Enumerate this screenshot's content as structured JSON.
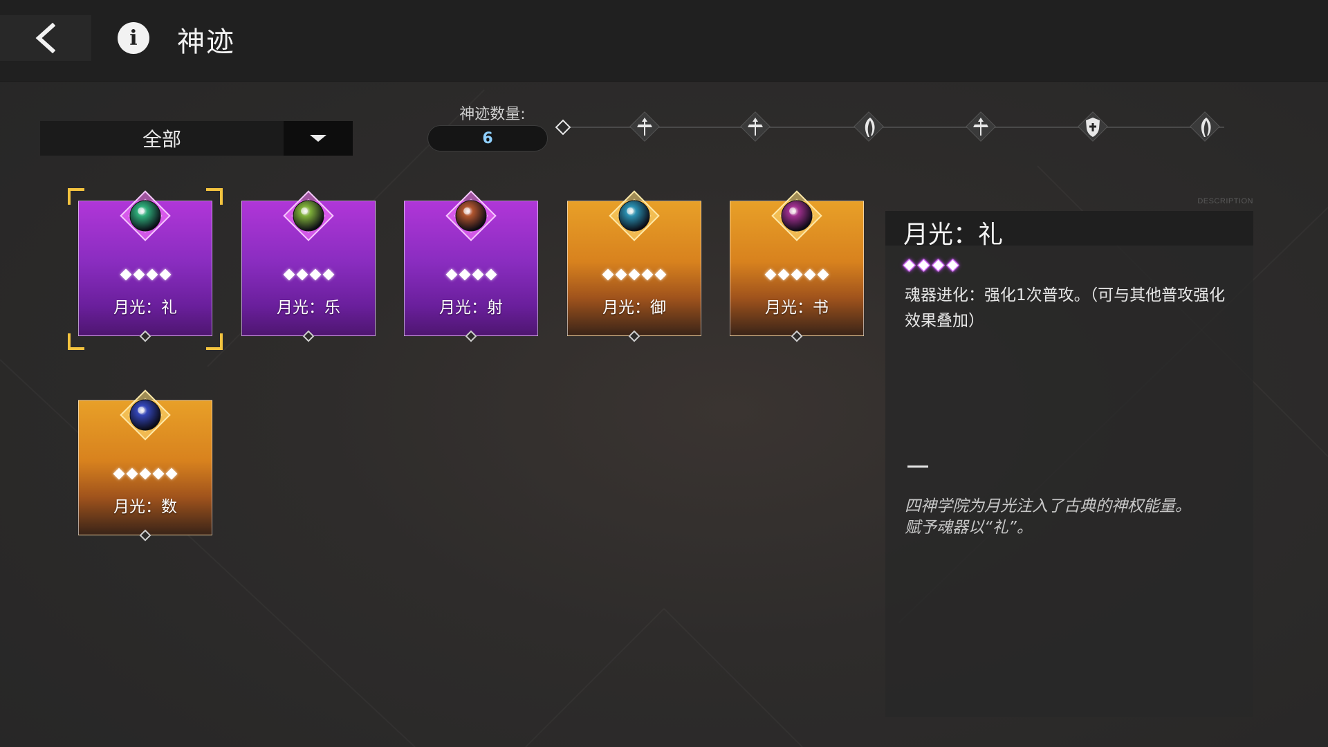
{
  "header": {
    "title": "神迹",
    "back_icon": "chevron-left-icon",
    "info_icon": "info-icon"
  },
  "filter": {
    "selected": "全部"
  },
  "count": {
    "label": "神迹数量:",
    "value": "6"
  },
  "milestones": [
    {
      "icon": "figure-icon"
    },
    {
      "icon": "figure-icon"
    },
    {
      "icon": "feather-icon"
    },
    {
      "icon": "figure-icon"
    },
    {
      "icon": "shield-icon"
    },
    {
      "icon": "feather-icon"
    }
  ],
  "cards": [
    {
      "name": "月光：礼",
      "rarity": 4,
      "theme": "purple",
      "gem_color": "#2fae7a",
      "selected": true
    },
    {
      "name": "月光：乐",
      "rarity": 4,
      "theme": "purple",
      "gem_color": "#7fb03a",
      "selected": false
    },
    {
      "name": "月光：射",
      "rarity": 4,
      "theme": "purple",
      "gem_color": "#b0552e",
      "selected": false
    },
    {
      "name": "月光：御",
      "rarity": 5,
      "theme": "gold",
      "gem_color": "#2a8fb0",
      "selected": false
    },
    {
      "name": "月光：书",
      "rarity": 5,
      "theme": "gold",
      "gem_color": "#a0308f",
      "selected": false
    },
    {
      "name": "月光：数",
      "rarity": 5,
      "theme": "gold",
      "gem_color": "#3346b8",
      "selected": false
    }
  ],
  "detail": {
    "caption": "DESCRIPTION",
    "title": "月光：礼",
    "rarity": 4,
    "effect": "魂器进化：强化1次普攻。（可与其他普攻强化效果叠加）",
    "lore": "四神学院为月光注入了古典的神权能量。赋予魂器以“礼”。"
  },
  "colors": {
    "purple_card": "#8a2dc0",
    "gold_card": "#d8821e",
    "selection": "#f3c33f",
    "count_value": "#8fd0ff"
  }
}
